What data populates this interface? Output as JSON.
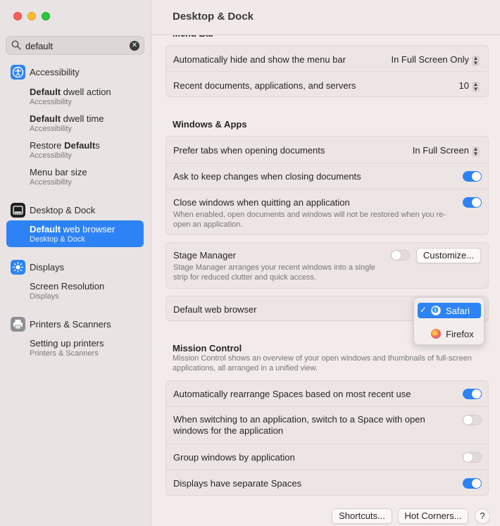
{
  "window": {
    "title": "Desktop & Dock"
  },
  "search": {
    "value": "default"
  },
  "sidebar": {
    "groups": [
      {
        "label": "Accessibility",
        "results": [
          {
            "pre": "Default",
            "post": " dwell action",
            "sub": "Accessibility"
          },
          {
            "pre": "Default",
            "post": " dwell time",
            "sub": "Accessibility"
          },
          {
            "pre": "Restore ",
            "bold": "Default",
            "post": "s",
            "sub": "Accessibility"
          },
          {
            "pre": "Menu bar size",
            "sub": "Accessibility"
          }
        ]
      },
      {
        "label": "Desktop & Dock",
        "selected": {
          "pre": "Default",
          "post": " web browser",
          "sub": "Desktop & Dock"
        }
      },
      {
        "label": "Displays",
        "results": [
          {
            "pre": "Screen Resolution",
            "sub": "Displays"
          }
        ]
      },
      {
        "label": "Printers & Scanners",
        "results": [
          {
            "pre": "Setting up printers",
            "sub": "Printers & Scanners"
          }
        ]
      }
    ]
  },
  "main": {
    "clipped_header": "Menu Bar",
    "menubar": {
      "autohide_label": "Automatically hide and show the menu bar",
      "autohide_value": "In Full Screen Only",
      "recent_label": "Recent documents, applications, and servers",
      "recent_value": "10"
    },
    "windows_apps": {
      "header": "Windows & Apps",
      "prefer_tabs_label": "Prefer tabs when opening documents",
      "prefer_tabs_value": "In Full Screen",
      "ask_keep_label": "Ask to keep changes when closing documents",
      "ask_keep_on": true,
      "close_windows_label": "Close windows when quitting an application",
      "close_windows_desc": "When enabled, open documents and windows will not be restored when you re-open an application.",
      "close_windows_on": true
    },
    "stage_manager": {
      "label": "Stage Manager",
      "desc": "Stage Manager arranges your recent windows into a single strip for reduced clutter and quick access.",
      "on": false,
      "customize_label": "Customize..."
    },
    "browser": {
      "label": "Default web browser",
      "options": [
        {
          "label": "Safari",
          "checked": true
        },
        {
          "label": "Firefox",
          "checked": false
        }
      ],
      "check_glyph": "✓"
    },
    "mission_control": {
      "header": "Mission Control",
      "desc": "Mission Control shows an overview of your open windows and thumbnails of full-screen applications, all arranged in a unified view.",
      "rearrange_label": "Automatically rearrange Spaces based on most recent use",
      "rearrange_on": true,
      "switch_label": "When switching to an application, switch to a Space with open windows for the application",
      "switch_on": false,
      "group_label": "Group windows by application",
      "group_on": false,
      "separate_label": "Displays have separate Spaces",
      "separate_on": true
    },
    "footer": {
      "shortcuts_label": "Shortcuts...",
      "hot_corners_label": "Hot Corners...",
      "help_label": "?"
    }
  },
  "colors": {
    "accent": "#2d83f5",
    "toggle_off": "#e2dbd9"
  },
  "icons": [
    "search-icon",
    "clear-icon",
    "accessibility-icon",
    "dock-icon",
    "displays-icon",
    "printer-icon",
    "safari-icon",
    "firefox-icon",
    "chevron-updown-icon"
  ]
}
